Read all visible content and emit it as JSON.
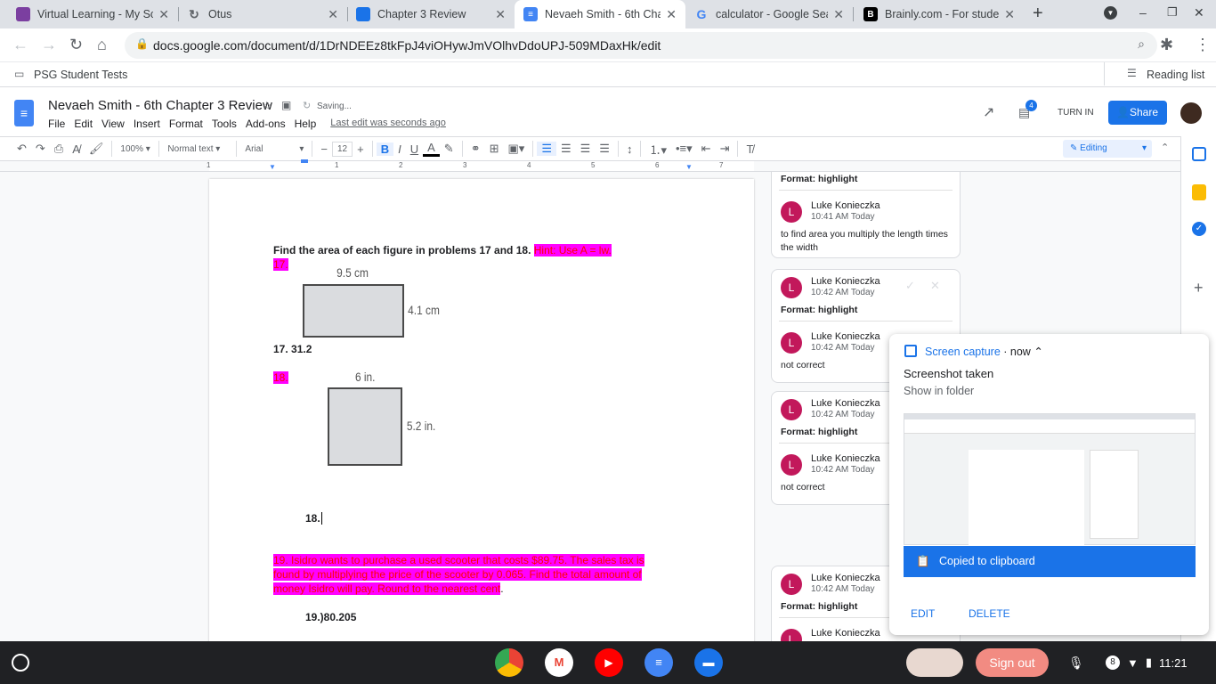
{
  "tabs": [
    {
      "label": "Virtual Learning - My Sc",
      "color": "#7b3fa0"
    },
    {
      "label": "Otus",
      "color": "#5f6368"
    },
    {
      "label": "Chapter 3 Review",
      "color": "#1a73e8"
    },
    {
      "label": "Nevaeh Smith - 6th Cha",
      "color": "#4285f4",
      "active": true
    },
    {
      "label": "calculator - Google Sea",
      "color": "#ea4335"
    },
    {
      "label": "Brainly.com - For stude",
      "color": "#000000"
    }
  ],
  "address": {
    "url": "docs.google.com/document/d/1DrNDEEz8tkFpJ4viOHywJmVOlhvDdoUPJ-509MDaxHk/edit"
  },
  "bookmarks": {
    "folder": "PSG Student Tests",
    "reading_list": "Reading list"
  },
  "doc": {
    "title": "Nevaeh Smith - 6th Chapter 3 Review",
    "status": "Saving...",
    "menu": [
      "File",
      "Edit",
      "View",
      "Insert",
      "Format",
      "Tools",
      "Add-ons",
      "Help"
    ],
    "last_edit": "Last edit was seconds ago",
    "turn_in": "TURN IN",
    "share": "Share",
    "comment_count": "4"
  },
  "toolbar": {
    "zoom": "100%",
    "style": "Normal text",
    "font": "Arial",
    "size": "12",
    "mode": "Editing"
  },
  "ruler": [
    "1",
    "1",
    "2",
    "3",
    "4",
    "5",
    "6",
    "7"
  ],
  "content": {
    "instruction": "Find the area of each figure in problems 17 and 18. ",
    "hint": "Hint: Use A = lw.",
    "p17": "17.",
    "fig1_top": "9.5 cm",
    "fig1_side": "4.1 cm",
    "ans17": "17. 31.2",
    "p18": "18.",
    "fig2_top": "6 in.",
    "fig2_side": "5.2 in.",
    "ans18": "18.",
    "q19": "19. Isidro wants to purchase a used scooter that costs $89.75. The sales tax is found by multiplying the price of the scooter by 0.065. Find the total amount of money Isidro will pay. Round to the nearest cent",
    "q19_end": ".",
    "ans19": "19.)80.205"
  },
  "comments": [
    {
      "format": "Format: highlight",
      "name": "Luke Konieczka",
      "time": "10:41 AM Today",
      "text": "to find area you multiply the length times the width"
    },
    {
      "name": "Luke Konieczka",
      "time": "10:42 AM Today",
      "format": "Format: highlight",
      "name2": "Luke Konieczka",
      "time2": "10:42 AM Today",
      "text": "not correct"
    },
    {
      "name": "Luke Konieczka",
      "time": "10:42 AM Today",
      "format": "Format: highlight",
      "name2": "Luke Konieczka",
      "time2": "10:42 AM Today",
      "text": "not correct"
    },
    {
      "name": "Luke Konieczka",
      "time": "10:42 AM Today",
      "format": "Format: highlight",
      "name2": "Luke Konieczka"
    }
  ],
  "notification": {
    "app": "Screen capture",
    "time": "now",
    "title": "Screenshot taken",
    "link": "Show in folder",
    "copied": "Copied to clipboard",
    "edit": "EDIT",
    "delete": "DELETE"
  },
  "shelf": {
    "sign_out": "Sign out",
    "badge": "8",
    "time": "11:21"
  }
}
